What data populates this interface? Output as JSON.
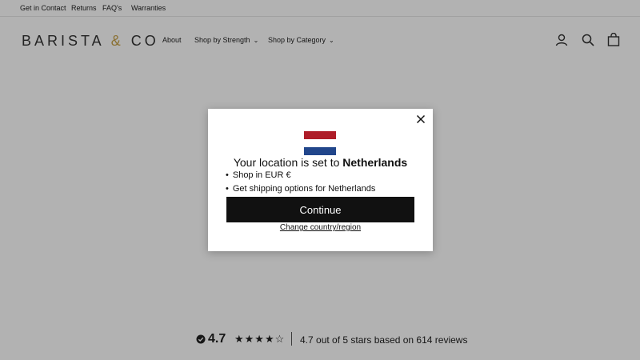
{
  "utility_links": [
    "Get in Contact",
    "Returns",
    "FAQ's",
    "Warranties"
  ],
  "header": {
    "logo_left": "BARISTA",
    "logo_amp": "&",
    "logo_right": "CO",
    "nav": {
      "about": "About",
      "shop_by_strength": "Shop by Strength",
      "shop_by_category": "Shop by Category"
    }
  },
  "reviews": {
    "score": "4.7",
    "stars": "★★★★☆",
    "summary": "4.7 out of 5 stars based on 614 reviews"
  },
  "modal": {
    "heading_prefix": "Your location is set to",
    "country": "Netherlands",
    "bullets": [
      "Shop in EUR €",
      "Get shipping options for Netherlands"
    ],
    "continue_label": "Continue",
    "change_label": "Change country/region",
    "flag_colors": [
      "#ae1c28",
      "#ffffff",
      "#21468b"
    ]
  },
  "colors": {
    "overlay": "rgba(0,0,0,0.30)",
    "button": "#111111",
    "logo_accent": "#c8a24a"
  }
}
